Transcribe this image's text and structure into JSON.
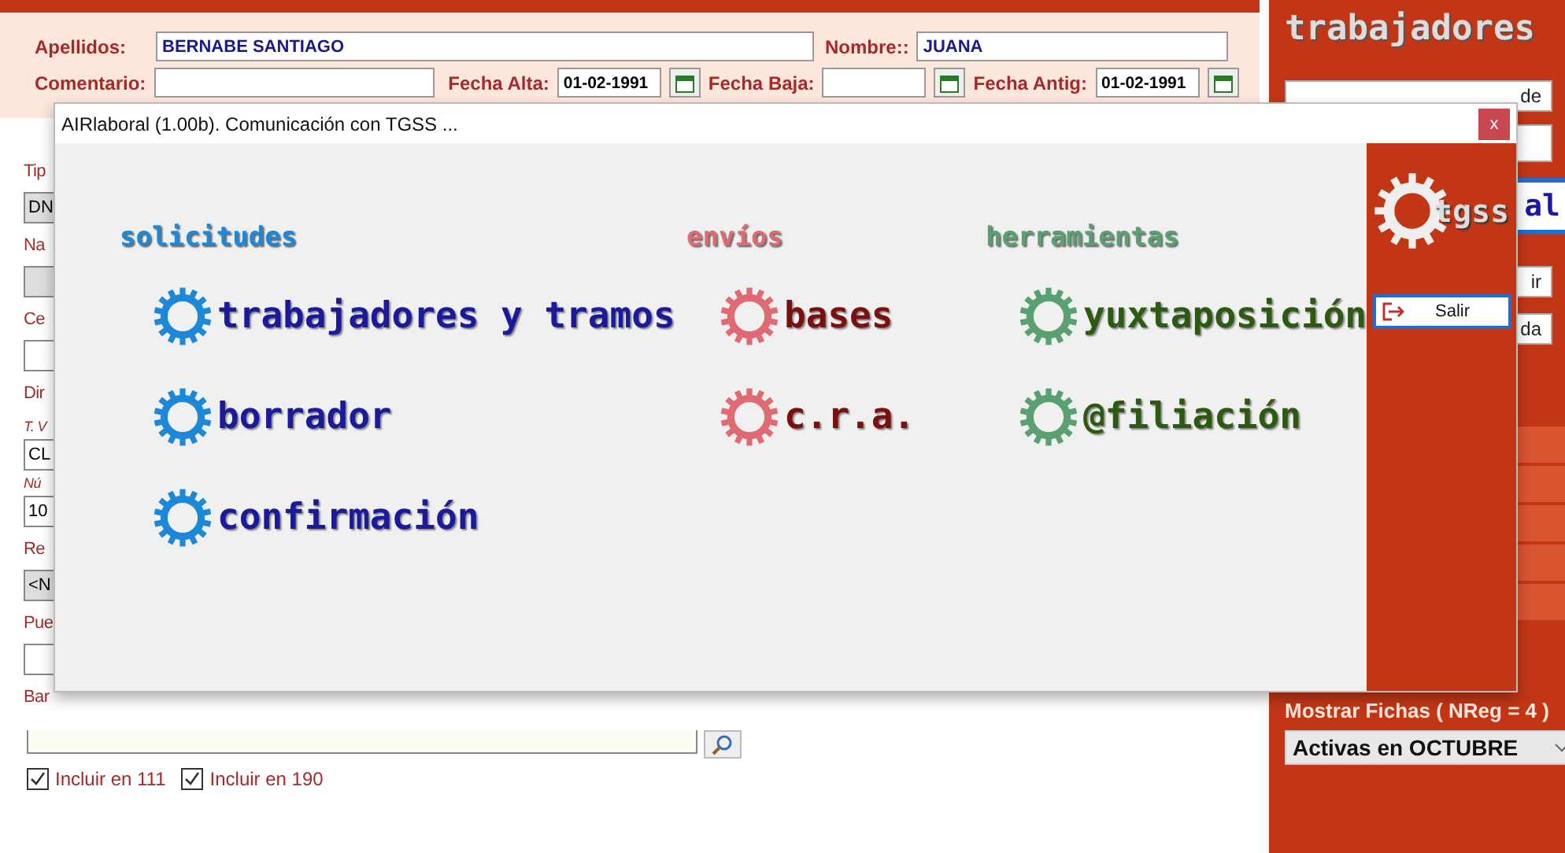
{
  "header": {
    "apellidos_label": "Apellidos:",
    "apellidos": "BERNABE SANTIAGO",
    "nombre_label": "Nombre::",
    "nombre": "JUANA",
    "comentario_label": "Comentario:",
    "dates": [
      {
        "label": "Fecha Alta:",
        "value": "01-02-1991"
      },
      {
        "label": "Fecha Baja:"
      },
      {
        "label": "Fecha Antig:",
        "value": "01-02-1991"
      }
    ]
  },
  "left_form": [
    {
      "kind": "label",
      "text": "Tip"
    },
    {
      "kind": "field",
      "text": "DN",
      "gray": true
    },
    {
      "kind": "label",
      "text": "Na"
    },
    {
      "kind": "field",
      "gray": true
    },
    {
      "kind": "label",
      "text": "Ce"
    },
    {
      "kind": "field",
      "gray": false
    },
    {
      "kind": "label",
      "text": "Dir"
    },
    {
      "kind": "hint",
      "text": "T. V"
    },
    {
      "kind": "field",
      "text": "CL",
      "gray": false
    },
    {
      "kind": "hint",
      "text": "Nú"
    },
    {
      "kind": "field",
      "text": "10",
      "gray": false
    },
    {
      "kind": "label",
      "text": "Re"
    },
    {
      "kind": "field",
      "text": "<N",
      "gray": true
    },
    {
      "kind": "label",
      "text": "Pue"
    },
    {
      "kind": "field",
      "gray": false
    },
    {
      "kind": "label",
      "text": "Bar"
    }
  ],
  "checkboxes": [
    {
      "label": "Incluir en 111",
      "checked": true
    },
    {
      "label": "Incluir en 190",
      "checked": true
    }
  ],
  "sidebar": {
    "title": "trabajadores",
    "fragments": [
      "de",
      "al",
      "ir",
      "da"
    ],
    "mostrar": "Mostrar Fichas ( NReg = 4 )",
    "select": "Activas en OCTUBRE"
  },
  "dialog": {
    "title": "AIRlaboral (1.00b). Comunicación con TGSS ...",
    "close": "x",
    "logo": "tgss",
    "exit": "Salir",
    "sections": [
      {
        "title": "solicitudes",
        "color": "#1e88d8",
        "items": [
          "trabajadores y tramos",
          "borrador",
          "confirmación"
        ]
      },
      {
        "title": "envíos",
        "color": "#e06a72",
        "items": [
          "bases",
          "c.r.a."
        ]
      },
      {
        "title": "herramientas",
        "color": "#5aa070",
        "items": [
          "yuxtaposición",
          "@filiación"
        ]
      }
    ]
  }
}
